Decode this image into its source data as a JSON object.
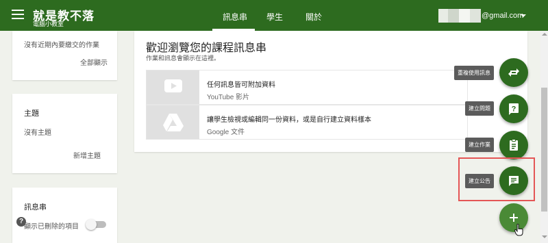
{
  "header": {
    "app_title": "就是教不落",
    "app_subtitle": "電腦小教室",
    "tabs": [
      {
        "label": "訊息串"
      },
      {
        "label": "學生"
      },
      {
        "label": "關於"
      }
    ],
    "account_email": "@gmail.com"
  },
  "sidebar": {
    "upcoming": {
      "empty_text": "沒有近期內要繳交的作業",
      "link": "全部顯示"
    },
    "topics": {
      "title": "主題",
      "empty_text": "沒有主題",
      "link": "新增主題"
    },
    "stream": {
      "title": "訊息串",
      "toggle_label": "顯示已刪除的項目"
    }
  },
  "main": {
    "welcome_title": "歡迎瀏覽您的課程訊息串",
    "welcome_sub": "作業和訊息會顯示在這裡。",
    "resources": [
      {
        "title": "任何訊息皆可附加資料",
        "sub": "YouTube 影片"
      },
      {
        "title": "讓學生檢視或編輯同一份資料，或是自行建立資料樣本",
        "sub": "Google 文件"
      }
    ]
  },
  "fab_menu": {
    "reuse_post": "重複使用訊息",
    "create_question": "建立問題",
    "create_assignment": "建立作業",
    "create_announcement": "建立公告"
  },
  "colors": {
    "brand": "#2d6b1f",
    "background": "#f0f2ec",
    "highlight": "#e45555"
  }
}
